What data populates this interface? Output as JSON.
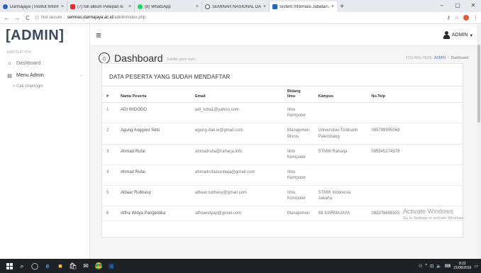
{
  "browser": {
    "tabs": [
      {
        "title": "Darmajaya | Institut Informati",
        "color": "#2a63b3"
      },
      {
        "title": "(7) full album Petepan ki",
        "color": "#e52d27"
      },
      {
        "title": "(8) WhatsApp",
        "color": "#25d366"
      },
      {
        "title": "SEMINAR NASIONAL DARMA",
        "color": "#4a4a4a"
      },
      {
        "title": "Sistem Informasi Jabatan Aka",
        "color": "#2a63b3"
      }
    ],
    "new_tab": "+",
    "url_security": "Not secure",
    "url_domain": "semnas.darmajaya.ac.id",
    "url_path": "/admin/index.php"
  },
  "sidebar": {
    "brand": "[ADMIN]",
    "nav_heading": "NAVIGATION",
    "items": [
      {
        "label": "Dashboard"
      },
      {
        "label": "Menu Admin"
      }
    ],
    "sub_items": [
      "> Cek Userlogin"
    ]
  },
  "header": {
    "user": "ADMIN"
  },
  "page": {
    "title": "Dashboard",
    "subtitle": "Subtitle goes here...",
    "breadcrumb_prefix": "YOU ARE HERE",
    "breadcrumb_link": "ADMIN",
    "breadcrumb_sep": "/",
    "breadcrumb_current": "Dashboard"
  },
  "table": {
    "title": "DATA PESERTA YANG SUDAH MENDAFTAR",
    "columns": [
      "#",
      "Nama Peserta",
      "Email",
      "Bidang Ilmu",
      "Kampus",
      "No.Telp"
    ],
    "rows": [
      [
        "1",
        "ADI WIDODO",
        "adi_tuba1@yahoo.com",
        "Ilmu Komputer",
        "",
        ""
      ],
      [
        "2",
        "Agung Anggoro Seto",
        "agung.dan.w@gmail.com",
        "Manajemen Bisnis",
        "Universitas Tridinanti Palembang",
        "085788995068"
      ],
      [
        "3",
        "Ahmad Rufai",
        "ahmadrufai@raharja.info",
        "Ilmu Komputer",
        "STMIK Raharja",
        "085945274576"
      ],
      [
        "4",
        "Ahmad Rufai",
        "ahmadrufaisunbaja@gmail.com",
        "Ilmu Komputer",
        "",
        ""
      ],
      [
        "5",
        "Albaar Rubhasy",
        "albaar.rubhasy@gmail.com",
        "Ilmu Komputer",
        "STMIK Indonesia Jakarta",
        ""
      ],
      [
        "6",
        "Alfira Widya Pangestika",
        "alfirawidyap@gmail.com",
        "Manajemen",
        "IIB DARMAJAYA",
        "082378688325"
      ]
    ]
  },
  "watermark": {
    "line1": "Activate Windows",
    "line2": "Go to Settings to activate Windows."
  },
  "taskbar": {
    "time": "8:22",
    "date": "21/08/2019"
  }
}
